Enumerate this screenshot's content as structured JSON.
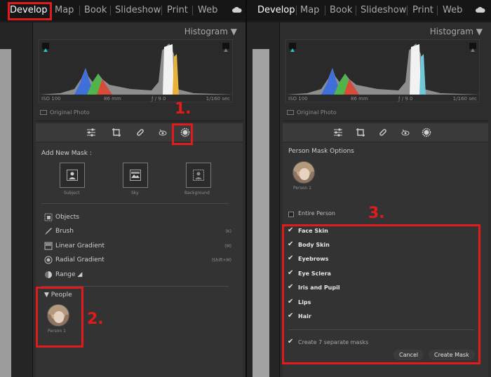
{
  "modules": [
    "Develop",
    "Map",
    "Book",
    "Slideshow",
    "Print",
    "Web"
  ],
  "histogram": {
    "title": "Histogram",
    "iso": "ISO 100",
    "focal": "86 mm",
    "aperture": "ƒ / 9.0",
    "shutter": "1/160 sec",
    "original_photo": "Original Photo"
  },
  "left": {
    "add_new_mask": "Add New Mask :",
    "subject": "Subject",
    "sky": "Sky",
    "background": "Background",
    "objects": "Objects",
    "brush": "Brush",
    "brush_key": "(K)",
    "linear": "Linear Gradient",
    "linear_key": "(M)",
    "radial": "Radial Gradient",
    "radial_key": "(Shift+M)",
    "range": "Range",
    "people": "People",
    "person": "Person 1"
  },
  "right": {
    "person_mask_options": "Person Mask Options",
    "person": "Person 1",
    "entire_person": "Entire Person",
    "options": [
      "Face Skin",
      "Body Skin",
      "Eyebrows",
      "Eye Sclera",
      "Iris and Pupil",
      "Lips",
      "Hair"
    ],
    "separate": "Create 7 separate masks",
    "cancel": "Cancel",
    "create": "Create Mask"
  },
  "annotations": {
    "n1": "1.",
    "n2": "2.",
    "n3": "3."
  },
  "colors": {
    "annotation_red": "#e11b1b",
    "panel": "#333333"
  }
}
